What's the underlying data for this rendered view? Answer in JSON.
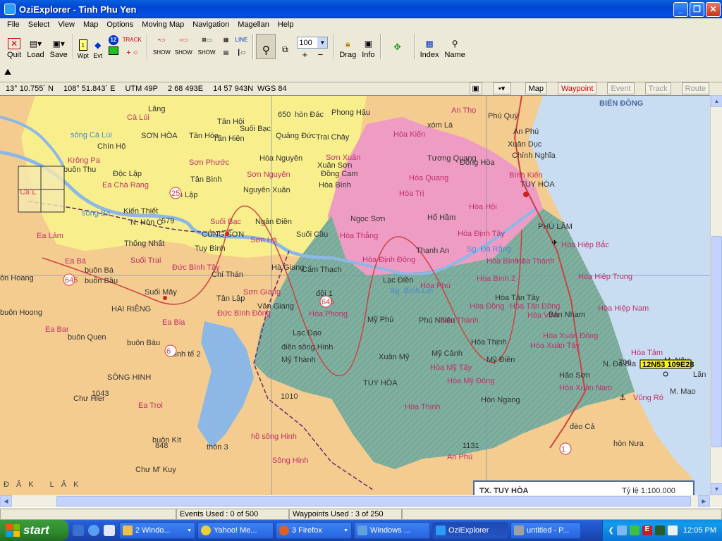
{
  "window": {
    "title": "OziExplorer - Tinh Phu Yen",
    "min": "_",
    "max": "❐",
    "close": "✕"
  },
  "menu": [
    "File",
    "Select",
    "View",
    "Map",
    "Options",
    "Moving Map",
    "Navigation",
    "Magellan",
    "Help"
  ],
  "toolbar": {
    "quit": "Quit",
    "load": "Load",
    "save": "Save",
    "wpt": "Wpt",
    "evt": "Evt",
    "wp_count": "12",
    "track": "TRACK",
    "line": "LINE",
    "show1": "SHOW",
    "show2": "SHOW",
    "show3": "SHOW",
    "zoom_value": "100",
    "plus": "+",
    "minus": "−",
    "drag": "Drag",
    "info": "Info",
    "index": "Index",
    "name": "Name"
  },
  "position": {
    "lat": "13° 10.755´ N",
    "lon": "108° 51.843´ E",
    "utm": "UTM  49P",
    "easting": "2 68 493E",
    "northing": "14 57 943N",
    "datum": "WGS 84"
  },
  "view_tabs": [
    {
      "label": "Map",
      "state": "normal"
    },
    {
      "label": "Waypoint",
      "state": "active"
    },
    {
      "label": "Event",
      "state": "disabled"
    },
    {
      "label": "Track",
      "state": "disabled"
    },
    {
      "label": "Route",
      "state": "disabled"
    }
  ],
  "map": {
    "sea_title": "BIỂN ĐÔNG",
    "waypoint_label": "12N53 109E28",
    "bottom_title": "TX. TUY HÒA",
    "scale": "Tỷ lệ 1:100.000",
    "province": "ĐẮK LẮK",
    "overview_text": "Cà L",
    "places": [
      {
        "t": "Cà Lúi",
        "c": "#c0306a"
      },
      {
        "t": "SƠN HÒA",
        "c": "#333"
      },
      {
        "t": "Chín Hộ",
        "c": "#333"
      },
      {
        "t": "Krông Pa",
        "c": "#c0306a"
      },
      {
        "t": "buôn Thu",
        "c": "#333"
      },
      {
        "t": "Độc Lập",
        "c": "#333"
      },
      {
        "t": "Ea Chà Rang",
        "c": "#c0306a"
      },
      {
        "t": "Kiến Thiết",
        "c": "#333"
      },
      {
        "t": "Tân Lập",
        "c": "#333"
      },
      {
        "t": "N. Hòn Ó",
        "c": "#333"
      },
      {
        "t": "Ea Lâm",
        "c": "#c0306a"
      },
      {
        "t": "Thống Nhất",
        "c": "#333"
      },
      {
        "t": "Suối Trai",
        "c": "#c0306a"
      },
      {
        "t": "Ea Bá",
        "c": "#c0306a"
      },
      {
        "t": "buôn Bá",
        "c": "#333"
      },
      {
        "t": "buôn Bầu",
        "c": "#333"
      },
      {
        "t": "ôn Hoang",
        "c": "#333"
      },
      {
        "t": "buôn Hoong",
        "c": "#333"
      },
      {
        "t": "HAI RIÊNG",
        "c": "#333"
      },
      {
        "t": "Ea Bia",
        "c": "#c0306a"
      },
      {
        "t": "Ea Bar",
        "c": "#c0306a"
      },
      {
        "t": "buôn Quen",
        "c": "#333"
      },
      {
        "t": "buôn Bàu",
        "c": "#333"
      },
      {
        "t": "kinh tế 2",
        "c": "#333"
      },
      {
        "t": "SÔNG HINH",
        "c": "#333"
      },
      {
        "t": "Chư Hler",
        "c": "#333"
      },
      {
        "t": "Ea Trol",
        "c": "#c0306a"
      },
      {
        "t": "buôn Kít",
        "c": "#333"
      },
      {
        "t": "Chư M' Kuy",
        "c": "#333"
      },
      {
        "t": "thôn 3",
        "c": "#333"
      },
      {
        "t": "hồ sông Hinh",
        "c": "#c0306a"
      },
      {
        "t": "Sông Hinh",
        "c": "#c0306a"
      },
      {
        "t": "Lăng",
        "c": "#333"
      },
      {
        "t": "Tân Hội",
        "c": "#333"
      },
      {
        "t": "Suối Bạc",
        "c": "#333"
      },
      {
        "t": "Tân Hòa",
        "c": "#333"
      },
      {
        "t": "Tân Hiên",
        "c": "#333"
      },
      {
        "t": "Sơn Phước",
        "c": "#c0306a"
      },
      {
        "t": "Tân Bình",
        "c": "#333"
      },
      {
        "t": "Sơn Nguyên",
        "c": "#c0306a"
      },
      {
        "t": "Hòa Nguyên",
        "c": "#333"
      },
      {
        "t": "Nguyên Xuân",
        "c": "#333"
      },
      {
        "t": "Suối Bạc",
        "c": "#c0306a"
      },
      {
        "t": "CỦNG SƠN",
        "c": "#333"
      },
      {
        "t": "Ngân Điền",
        "c": "#333"
      },
      {
        "t": "Sơn Hà",
        "c": "#c0306a"
      },
      {
        "t": "Suối Cầu",
        "c": "#333"
      },
      {
        "t": "Tuy Bình",
        "c": "#333"
      },
      {
        "t": "Đức Bình Tây",
        "c": "#c0306a"
      },
      {
        "t": "Chí Thán",
        "c": "#333"
      },
      {
        "t": "Hà Giang",
        "c": "#333"
      },
      {
        "t": "Suối Mây",
        "c": "#333"
      },
      {
        "t": "Sơn Giang",
        "c": "#c0306a"
      },
      {
        "t": "Tân Lập",
        "c": "#333"
      },
      {
        "t": "Vân Giang",
        "c": "#333"
      },
      {
        "t": "Đức Bình Đông",
        "c": "#c0306a"
      },
      {
        "t": "Sơn Xuân",
        "c": "#c0306a"
      },
      {
        "t": "Phong Hậu",
        "c": "#333"
      },
      {
        "t": "Trai Chảy",
        "c": "#333"
      },
      {
        "t": "Xuân Sơn",
        "c": "#333"
      },
      {
        "t": "Đồng Cam",
        "c": "#333"
      },
      {
        "t": "Hòa Bình",
        "c": "#333"
      },
      {
        "t": "hòn Đác",
        "c": "#333"
      },
      {
        "t": "Quảng Đức",
        "c": "#333"
      },
      {
        "t": "An Thọ",
        "c": "#c0306a"
      },
      {
        "t": "xóm Lá",
        "c": "#333"
      },
      {
        "t": "Hòa Kiến",
        "c": "#c0306a"
      },
      {
        "t": "Tương Quang",
        "c": "#333"
      },
      {
        "t": "Đồng Hòa",
        "c": "#333"
      },
      {
        "t": "Hòa Quang",
        "c": "#c0306a"
      },
      {
        "t": "Hòa Trị",
        "c": "#c0306a"
      },
      {
        "t": "Hòa Hội",
        "c": "#c0306a"
      },
      {
        "t": "Ngọc Sơn",
        "c": "#333"
      },
      {
        "t": "Hổ Hầm",
        "c": "#333"
      },
      {
        "t": "Hòa Thắng",
        "c": "#c0306a"
      },
      {
        "t": "Hòa Định Tây",
        "c": "#c0306a"
      },
      {
        "t": "Hòa Định Đông",
        "c": "#c0306a"
      },
      {
        "t": "Thạnh An",
        "c": "#333"
      },
      {
        "t": "Cẩm Thạch",
        "c": "#333"
      },
      {
        "t": "Lạc Điền",
        "c": "#333"
      },
      {
        "t": "đội 1",
        "c": "#333"
      },
      {
        "t": "Hòa Phong",
        "c": "#c0306a"
      },
      {
        "t": "Hòa Phú",
        "c": "#c0306a"
      },
      {
        "t": "Mỹ Phú",
        "c": "#333"
      },
      {
        "t": "Phú Nhiêu",
        "c": "#333"
      },
      {
        "t": "Sơn Thành",
        "c": "#c0306a"
      },
      {
        "t": "Lạc Đạo",
        "c": "#333"
      },
      {
        "t": "điền sông Hinh",
        "c": "#333"
      },
      {
        "t": "Mỹ Thành",
        "c": "#333"
      },
      {
        "t": "Xuân Mỹ",
        "c": "#333"
      },
      {
        "t": "Mỹ Cảnh",
        "c": "#333"
      },
      {
        "t": "Hòa Mỹ Tây",
        "c": "#c0306a"
      },
      {
        "t": "TUY HÒA",
        "c": "#333"
      },
      {
        "t": "Hòa Mỹ Đông",
        "c": "#c0306a"
      },
      {
        "t": "Hòa Thịnh",
        "c": "#c0306a"
      },
      {
        "t": "Hòn Ngang",
        "c": "#333"
      },
      {
        "t": "An Phú",
        "c": "#c0306a"
      },
      {
        "t": "Phú Quý",
        "c": "#333"
      },
      {
        "t": "Xuân Dục",
        "c": "#333"
      },
      {
        "t": "An Phú",
        "c": "#333"
      },
      {
        "t": "Chính Nghĩa",
        "c": "#333"
      },
      {
        "t": "Bình Kiến",
        "c": "#c0306a"
      },
      {
        "t": "TUY HÒA",
        "c": "#333"
      },
      {
        "t": "PHÚ LÂM",
        "c": "#333"
      },
      {
        "t": "Hòa Hiệp Bắc",
        "c": "#c0306a"
      },
      {
        "t": "Hòa Bình 2",
        "c": "#c0306a"
      },
      {
        "t": "Hòa Bình 1",
        "c": "#c0306a"
      },
      {
        "t": "Hòa Thành",
        "c": "#c0306a"
      },
      {
        "t": "Hòa Hiệp Trung",
        "c": "#c0306a"
      },
      {
        "t": "Hòa Tân Tây",
        "c": "#333"
      },
      {
        "t": "Hòa Đồng",
        "c": "#c0306a"
      },
      {
        "t": "Hòa Tân Đông",
        "c": "#c0306a"
      },
      {
        "t": "Hòa Vinh",
        "c": "#c0306a"
      },
      {
        "t": "Bàn Nham",
        "c": "#333"
      },
      {
        "t": "Hòa Hiệp Nam",
        "c": "#c0306a"
      },
      {
        "t": "Hòa Thịnh",
        "c": "#333"
      },
      {
        "t": "Mỹ Điền",
        "c": "#333"
      },
      {
        "t": "Hòa Xuân Tây",
        "c": "#c0306a"
      },
      {
        "t": "Hòa Xuân Đông",
        "c": "#c0306a"
      },
      {
        "t": "Hòa Tâm",
        "c": "#c0306a"
      },
      {
        "t": "N. Đá Bia",
        "c": "#333"
      },
      {
        "t": "M. Nậy",
        "c": "#333"
      },
      {
        "t": "Hảo Sơn",
        "c": "#333"
      },
      {
        "t": "Hòa Xuân Nam",
        "c": "#c0306a"
      },
      {
        "t": "M. Mao",
        "c": "#333"
      },
      {
        "t": "Vũng Rô",
        "c": "#c0306a"
      },
      {
        "t": "đèo Cả",
        "c": "#333"
      },
      {
        "t": "hòn Nưa",
        "c": "#333"
      },
      {
        "t": "Lăn",
        "c": "#333"
      },
      {
        "t": "sông Cà Lúi",
        "c": "#4a8ad0"
      },
      {
        "t": "sông Ba",
        "c": "#4a8ad0"
      },
      {
        "t": "Sg. Đà Rằng",
        "c": "#4a8ad0"
      },
      {
        "t": "Sg. Bình Lợi",
        "c": "#4a8ad0"
      }
    ],
    "elevations": [
      "579",
      "650",
      "1043",
      "848",
      "1010",
      "1131",
      "706"
    ],
    "road_numbers": [
      "25",
      "645",
      "645",
      "6",
      "1"
    ]
  },
  "status": {
    "events": "Events Used : 0 of 500",
    "waypoints": "Waypoints Used : 3 of 250"
  },
  "taskbar": {
    "start": "start",
    "tasks": [
      {
        "label": "2 Windo...",
        "color": "#f0c040",
        "active": false
      },
      {
        "label": "Yahoo! Me...",
        "color": "#f0d030",
        "active": false
      },
      {
        "label": "3 Firefox",
        "color": "#e06020",
        "active": false
      },
      {
        "label": "Windows ...",
        "color": "#60a0e0",
        "active": false
      },
      {
        "label": "OziExplorer",
        "color": "#2a9df4",
        "active": true
      },
      {
        "label": "untitled - P...",
        "color": "#a0a0a0",
        "active": false
      }
    ],
    "clock": "12:05 PM"
  },
  "colors": {
    "yellow": "#F8EF8C",
    "orange": "#F5CC90",
    "pink": "#EE9CC4",
    "green": "#7FAF9F",
    "sea": "#C9DDF2",
    "river": "#8DB8E6"
  }
}
